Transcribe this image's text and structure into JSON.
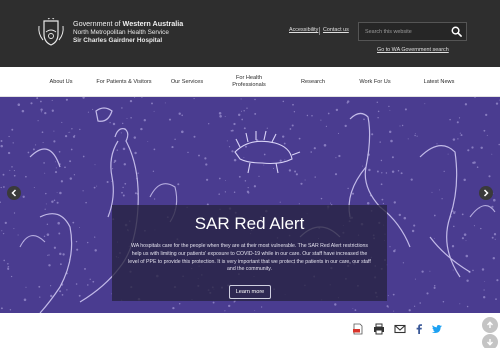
{
  "header": {
    "gov_prefix": "Government of ",
    "gov_state": "Western Australia",
    "service": "North Metropolitan Health Service",
    "hospital": "Sir Charles Gairdner Hospital",
    "util_links": [
      "Accessibility",
      "Contact us"
    ],
    "search_placeholder": "Search this website",
    "go_wa": "Go to WA Government search"
  },
  "nav": {
    "items": [
      {
        "label": "About Us"
      },
      {
        "label": "For Patients & Visitors"
      },
      {
        "label": "Our Services"
      },
      {
        "label": "For Health Professionals"
      },
      {
        "label": "Research"
      },
      {
        "label": "Work For Us"
      },
      {
        "label": "Latest News"
      }
    ]
  },
  "hero": {
    "title": "SAR Red Alert",
    "body": "WA hospitals care for the people when they are at their most vulnerable. The SAR Red Alert restrictions help us with limiting our patients' exposure to COVID-19 while in our care. Our staff have increased the level of PPE to provide this protection. It is very important that we protect the patients in our care, our staff and the community.",
    "button": "Learn more"
  },
  "share": {
    "icons": [
      "pdf-icon",
      "print-icon",
      "email-icon",
      "facebook-icon",
      "twitter-icon"
    ]
  },
  "colors": {
    "header_bg": "#2e2e2e",
    "hero_bg": "#4a3c90",
    "panel_bg": "#262240"
  }
}
